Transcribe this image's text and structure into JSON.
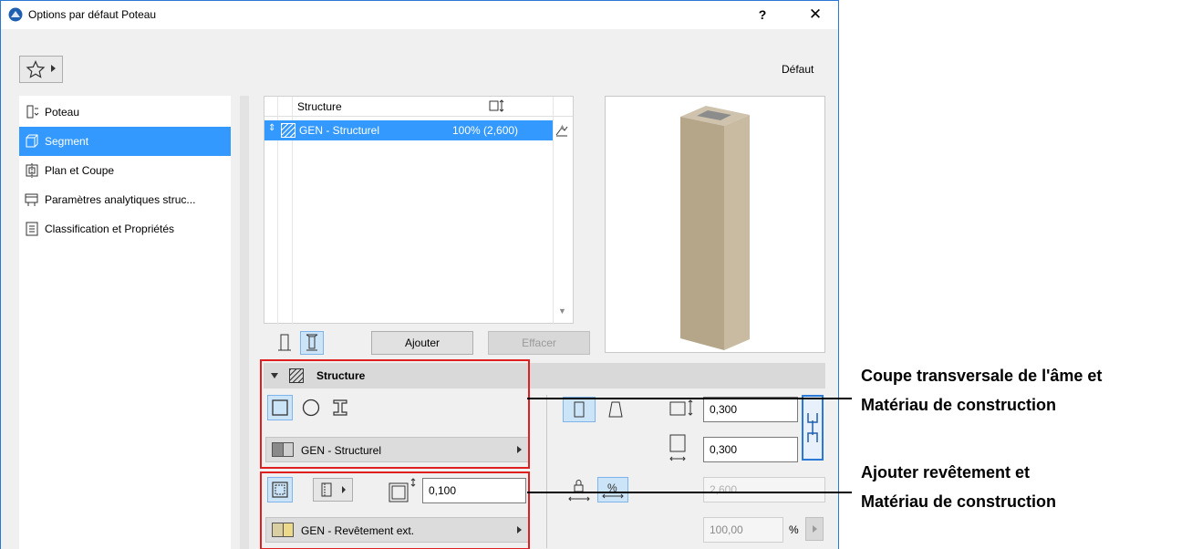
{
  "window": {
    "title": "Options par défaut Poteau",
    "help_label": "?",
    "close_label": "✕"
  },
  "toolbar": {
    "favorites_icon": "star-icon",
    "default_label": "Défaut"
  },
  "nav": {
    "items": [
      {
        "label": "Poteau",
        "icon": "column-icon",
        "active": false
      },
      {
        "label": "Segment",
        "icon": "segment-icon",
        "active": true
      },
      {
        "label": "Plan et Coupe",
        "icon": "plan-section-icon",
        "active": false
      },
      {
        "label": "Paramètres analytiques struc...",
        "icon": "analytical-icon",
        "active": false
      },
      {
        "label": "Classification et Propriétés",
        "icon": "properties-icon",
        "active": false
      }
    ]
  },
  "segments_list": {
    "col_structure": "Structure",
    "col_height_icon": "height-icon",
    "rows": [
      {
        "name": "GEN - Structurel",
        "value": "100% (2,600)",
        "selected": true
      }
    ]
  },
  "segment_buttons": {
    "add_label": "Ajouter",
    "delete_label": "Effacer"
  },
  "structure_section": {
    "title": "Structure",
    "core_material": "GEN - Structurel",
    "width_value": "0,300",
    "depth_value": "0,300",
    "length_value": "2,600",
    "percent_value": "100,00",
    "percent_unit": "%"
  },
  "veneer": {
    "thickness_value": "0,100",
    "material": "GEN - Revêtement ext."
  },
  "annotations": {
    "callout1_line1": "Coupe transversale de l'âme et",
    "callout1_line2": "Matériau de construction",
    "callout2_line1": "Ajouter revêtement et",
    "callout2_line2": "Matériau de construction"
  },
  "colors": {
    "accent": "#3399ff",
    "highlight_box": "#e02020",
    "column_tan": "#b5a68a"
  }
}
